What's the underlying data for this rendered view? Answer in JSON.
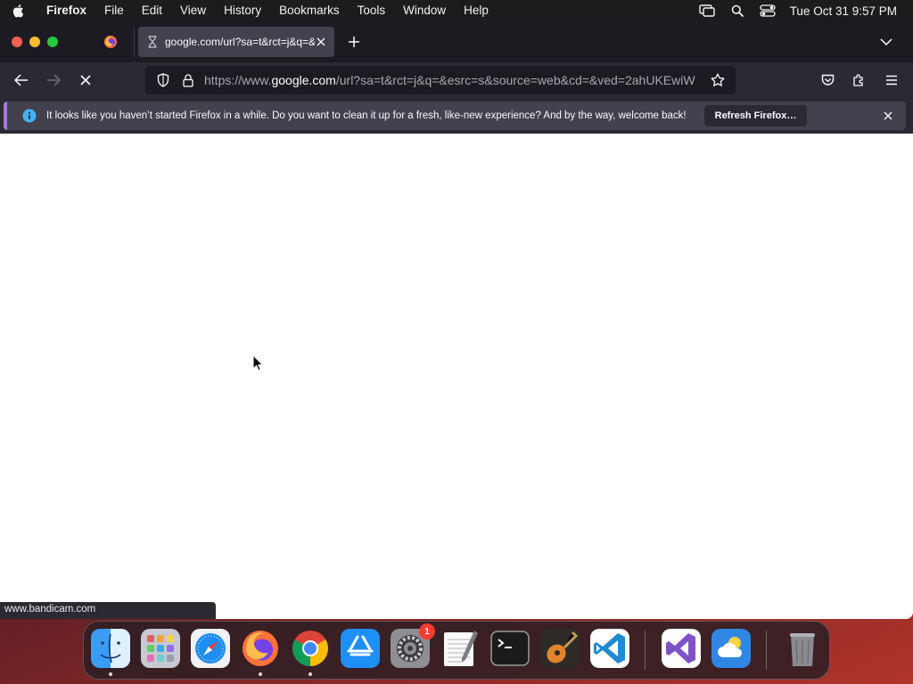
{
  "menubar": {
    "app_name": "Firefox",
    "menus": [
      "File",
      "Edit",
      "View",
      "History",
      "Bookmarks",
      "Tools",
      "Window",
      "Help"
    ],
    "clock": "Tue Oct 31  9:57 PM"
  },
  "tabs": {
    "active_title": "google.com/url?sa=t&rct=j&q=&"
  },
  "urlbar": {
    "scheme": "https://www.",
    "host": "google.com",
    "path": "/url?sa=t&rct=j&q=&esrc=s&source=web&cd=&ved=2ahUKEwiW"
  },
  "notification": {
    "message": "It looks like you haven’t started Firefox in a while. Do you want to clean it up for a fresh, like-new experience? And by the way, welcome back!",
    "button_label": "Refresh Firefox…"
  },
  "status_bar": {
    "text": "www.bandicam.com"
  },
  "dock": {
    "apps": [
      "Finder",
      "Launchpad",
      "Safari",
      "Firefox",
      "Chrome",
      "App Store",
      "System Settings",
      "TextEdit",
      "Terminal",
      "GarageBand",
      "Visual Studio Code",
      "Visual Studio",
      "Weather",
      "Trash"
    ],
    "system_settings_badge": "1"
  },
  "colors": {
    "toolbar": "#2b2a33",
    "tabbar": "#1c1b22",
    "accent_info": "#3fb4f7",
    "notice_border": "#a479dc"
  }
}
